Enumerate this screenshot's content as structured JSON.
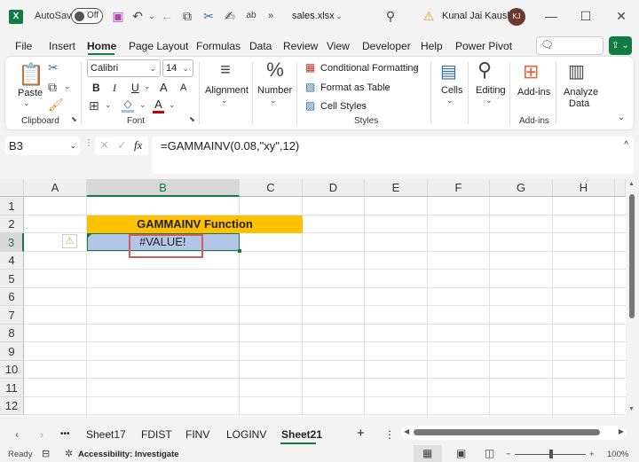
{
  "titlebar": {
    "app_icon": "excel-icon",
    "autosave_label": "AutoSave",
    "autosave_state": "Off",
    "filename": "sales.xlsx",
    "user_name": "Kunal Jai Kaushik",
    "user_initials": "KJ",
    "icons": [
      "save-icon",
      "undo-icon",
      "redo-icon",
      "copy-icon",
      "cut-icon",
      "sign-icon",
      "spelling-icon",
      "more-icon",
      "search-icon",
      "warning-icon",
      "minimize-icon",
      "maximize-icon",
      "close-icon"
    ]
  },
  "menu": {
    "items": [
      "File",
      "Insert",
      "Home",
      "Page Layout",
      "Formulas",
      "Data",
      "Review",
      "View",
      "Developer",
      "Help",
      "Power Pivot"
    ],
    "active": "Home",
    "comments_label": "Comments"
  },
  "ribbon": {
    "clipboard": {
      "paste_label": "Paste",
      "group_label": "Clipboard"
    },
    "font": {
      "font_name": "Calibri",
      "font_size": "14",
      "bold": "B",
      "italic": "I",
      "underline": "U",
      "grow": "A",
      "shrink": "A",
      "font_color_glyph": "A",
      "group_label": "Font"
    },
    "alignment_label": "Alignment",
    "number_label": "Number",
    "styles": {
      "conditional_formatting": "Conditional Formatting",
      "format_as_table": "Format as Table",
      "cell_styles": "Cell Styles",
      "group_label": "Styles"
    },
    "cells_label": "Cells",
    "editing_label": "Editing",
    "addins_label": "Add-ins",
    "addins_group_label": "Add-ins",
    "analyze_label_1": "Analyze",
    "analyze_label_2": "Data",
    "font_color_hex": "#c00000",
    "fill_color_hex": "#9dc3e6"
  },
  "formula_bar": {
    "name_box": "B3",
    "fx": "fx",
    "formula": "=GAMMAINV(0.08,\"xy\",12)"
  },
  "grid": {
    "columns": [
      "A",
      "B",
      "C",
      "D",
      "E",
      "F",
      "G",
      "H"
    ],
    "rows": [
      "1",
      "2",
      "3",
      "4",
      "5",
      "6",
      "7",
      "8",
      "9",
      "10",
      "11",
      "12"
    ],
    "selected_column": "B",
    "selected_row": "3",
    "cells": {
      "B2": "GAMMAINV Function",
      "B3": "#VALUE!"
    },
    "header_fill_hex": "#ffc000",
    "result_fill_hex": "#b4c6e7"
  },
  "sheet_tabs": {
    "tabs": [
      "Sheet17",
      "FDIST",
      "FINV",
      "LOGINV",
      "Sheet21"
    ],
    "active": "Sheet21",
    "more": "•••",
    "add": "+"
  },
  "status_bar": {
    "ready": "Ready",
    "accessibility": "Accessibility: Investigate",
    "zoom": "100%",
    "zoom_minus": "−",
    "zoom_plus": "+"
  }
}
